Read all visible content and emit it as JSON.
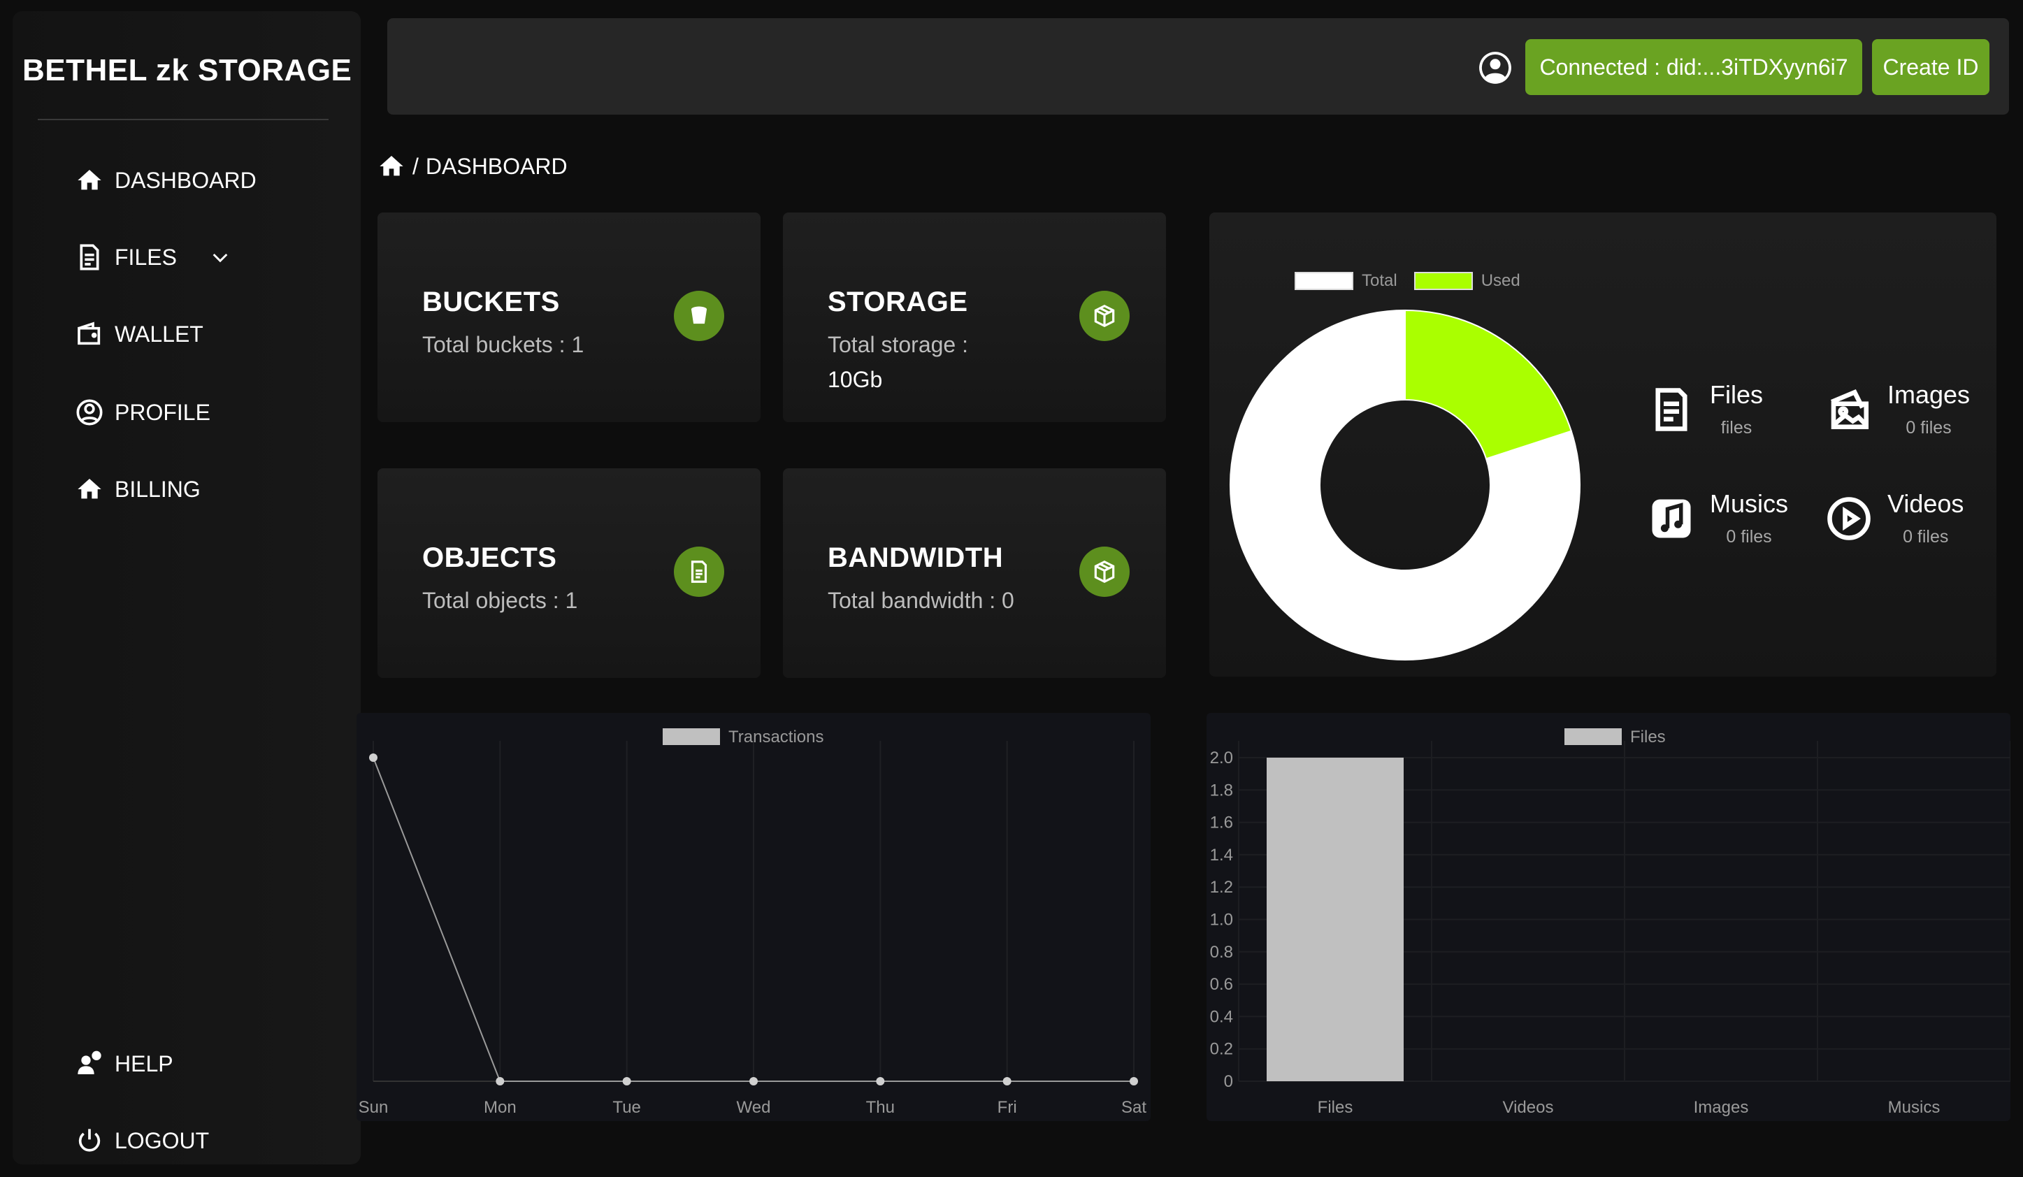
{
  "app": {
    "brand": "BETHEL zk STORAGE"
  },
  "sidebar": {
    "items": [
      {
        "label": "DASHBOARD",
        "icon": "home-icon"
      },
      {
        "label": "FILES",
        "icon": "document-icon"
      },
      {
        "label": "WALLET",
        "icon": "wallet-icon"
      },
      {
        "label": "PROFILE",
        "icon": "user-circle-icon"
      },
      {
        "label": "BILLING",
        "icon": "home-icon"
      }
    ],
    "bottom_items": [
      {
        "label": "HELP",
        "icon": "help-icon"
      },
      {
        "label": "LOGOUT",
        "icon": "power-icon"
      }
    ]
  },
  "header": {
    "connected_label": "Connected : did:...3iTDXyyn6i7",
    "create_id_label": "Create ID"
  },
  "breadcrumb": {
    "separator": "/",
    "current": "DASHBOARD"
  },
  "stats": {
    "buckets": {
      "title": "BUCKETS",
      "subtitle": "Total buckets : 1"
    },
    "storage": {
      "title": "STORAGE",
      "subtitle": "Total storage :",
      "value": "10Gb"
    },
    "objects": {
      "title": "OBJECTS",
      "subtitle": "Total objects : 1"
    },
    "bandwidth": {
      "title": "BANDWIDTH",
      "subtitle": "Total bandwidth : 0"
    }
  },
  "file_types": [
    {
      "name": "Files",
      "count": "files",
      "icon": "file-icon"
    },
    {
      "name": "Images",
      "count": "0 files",
      "icon": "images-icon"
    },
    {
      "name": "Musics",
      "count": "0 files",
      "icon": "music-icon"
    },
    {
      "name": "Videos",
      "count": "0 files",
      "icon": "play-icon"
    }
  ],
  "colors": {
    "accent_green": "#6aa322",
    "used_green": "#aaff00",
    "total_white": "#ffffff",
    "bar_gray": "#c0c0c0"
  },
  "chart_data": [
    {
      "type": "pie",
      "labels": [
        "Total",
        "Used"
      ],
      "values": [
        80,
        20
      ],
      "colors": [
        "#ffffff",
        "#aaff00"
      ],
      "legend": "top"
    },
    {
      "type": "line",
      "series": [
        {
          "name": "Transactions",
          "values": [
            1,
            0,
            0,
            0,
            0,
            0,
            0
          ]
        }
      ],
      "categories": [
        "Sun",
        "Mon",
        "Tue",
        "Wed",
        "Thu",
        "Fri",
        "Sat"
      ],
      "legend": "top"
    },
    {
      "type": "bar",
      "series": [
        {
          "name": "Files",
          "values": [
            2,
            0,
            0,
            0
          ]
        }
      ],
      "categories": [
        "Files",
        "Videos",
        "Images",
        "Musics"
      ],
      "yticks": [
        "0",
        "0.2",
        "0.4",
        "0.6",
        "0.8",
        "1.0",
        "1.2",
        "1.4",
        "1.6",
        "1.8",
        "2.0"
      ],
      "ylim": [
        0,
        2
      ],
      "legend": "top"
    }
  ]
}
